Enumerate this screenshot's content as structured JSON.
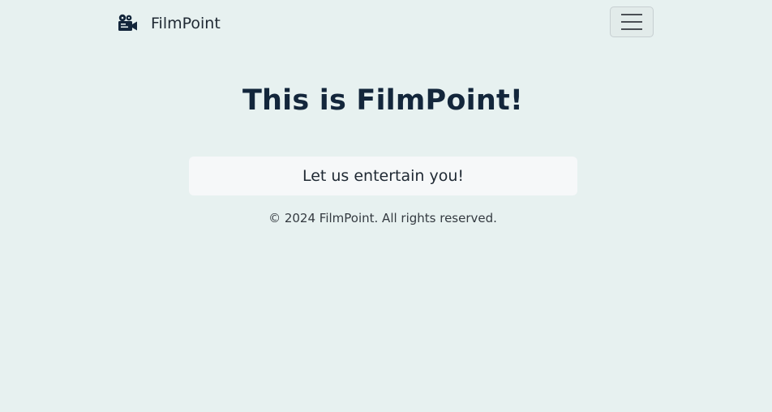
{
  "navbar": {
    "brand_icon": "film-camera-icon",
    "brand_name": "FilmPoint",
    "menu_icon": "hamburger-menu-icon"
  },
  "hero": {
    "headline": "This is FilmPoint!",
    "tagline": "Let us entertain you!"
  },
  "footer": {
    "copyright": "© 2024 FilmPoint. All rights reserved."
  },
  "colors": {
    "background": "#e7f1f0",
    "heading": "#13263b",
    "tagline_box": "#f6f8f9",
    "toggler_border": "#c7cfd1"
  }
}
